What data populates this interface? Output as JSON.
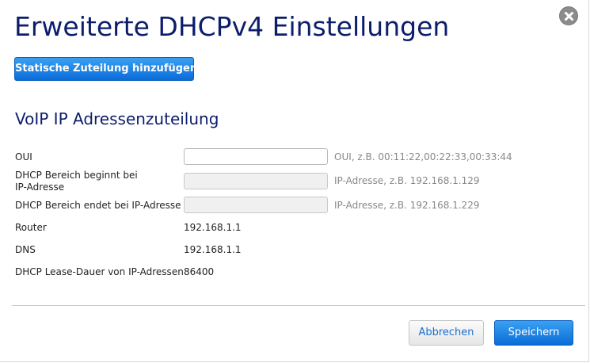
{
  "dialog": {
    "title": "Erweiterte DHCPv4 Einstellungen",
    "close_icon": "close-icon"
  },
  "actions": {
    "add_static_label": "Statische Zuteilung hinzufügen",
    "cancel_label": "Abbrechen",
    "save_label": "Speichern"
  },
  "section": {
    "heading": "VoIP IP Adressenzuteilung"
  },
  "fields": {
    "oui": {
      "label": "OUI",
      "value": "",
      "hint": "OUI, z.B. 00:11:22,00:22:33,00:33:44"
    },
    "range_start": {
      "label_line1": "DHCP Bereich beginnt bei",
      "label_line2": "IP-Adresse",
      "value": "",
      "hint": "IP-Adresse, z.B. 192.168.1.129"
    },
    "range_end": {
      "label": "DHCP Bereich endet bei IP-Adresse",
      "value": "",
      "hint": "IP-Adresse, z.B. 192.168.1.229"
    },
    "router": {
      "label": "Router",
      "value": "192.168.1.1"
    },
    "dns": {
      "label": "DNS",
      "value": "192.168.1.1"
    },
    "lease": {
      "label": "DHCP Lease-Dauer von IP-Adressen",
      "value": "86400"
    }
  },
  "colors": {
    "title": "#0c1d6b",
    "primary_button": "#1a7be6",
    "link_text": "#1a6fd0",
    "hint_text": "#888888"
  }
}
